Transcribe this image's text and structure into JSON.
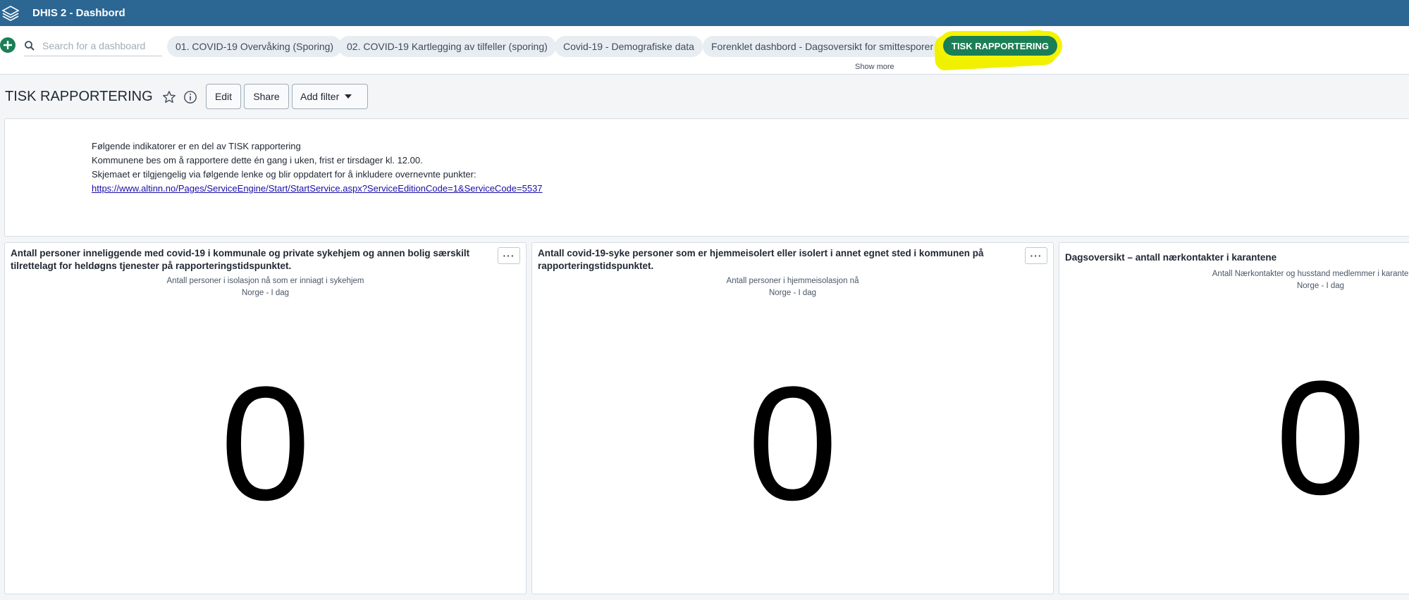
{
  "header": {
    "title": "DHIS 2 - Dashbord",
    "icon": "dhis2-logo-icon",
    "background": "#2c6693"
  },
  "controlbar": {
    "add_icon": "plus-circle-icon",
    "search_icon": "search-icon",
    "search_placeholder": "Search for a dashboard",
    "chips": [
      {
        "label": "01. COVID-19 Overvåking (Sporing)",
        "selected": false
      },
      {
        "label": "02. COVID-19 Kartlegging av tilfeller (sporing)",
        "selected": false
      },
      {
        "label": "Covid-19 - Demografiske data",
        "selected": false
      },
      {
        "label": "Forenklet dashbord - Dagsoversikt for smittesporer",
        "selected": false
      },
      {
        "label": "TISK RAPPORTERING",
        "selected": true
      }
    ],
    "show_more": "Show more",
    "accent_color": "#1b7f55",
    "highlight_color": "#f4f400"
  },
  "titlebar": {
    "title": "TISK RAPPORTERING",
    "star_icon": "star-outline-icon",
    "info_icon": "info-circle-icon",
    "edit_label": "Edit",
    "share_label": "Share",
    "add_filter_label": "Add filter",
    "dropdown_icon": "caret-down-icon"
  },
  "textitem": {
    "line1": "Følgende indikatorer er en del av TISK rapportering",
    "line2": "Kommunene bes om å rapportere dette én gang i uken, frist er tirsdager kl. 12.00.",
    "line3": "Skjemaet er tilgjengelig via følgende lenke og blir oppdatert for å inkludere overnevnte punkter:",
    "link": "https://www.altinn.no/Pages/ServiceEngine/Start/StartService.aspx?ServiceEditionCode=1&ServiceCode=5537"
  },
  "panels": [
    {
      "title": "Antall personer inneliggende med covid-19 i kommunale og private sykehjem og annen bolig særskilt tilrettelagt for heldøgns tjenester på rapporteringstidspunktet.",
      "subtitle": "Antall personer i isolasjon nå som er inniagt i sykehjem",
      "period": "Norge - I dag",
      "value": "0",
      "menu_label": "···"
    },
    {
      "title": "Antall covid-19-syke personer som er hjemmeisolert eller isolert i annet egnet sted i kommunen på rapporteringstidspunktet.",
      "subtitle": "Antall personer i hjemmeisolasjon nå",
      "period": "Norge - I dag",
      "value": "0",
      "menu_label": "···"
    },
    {
      "title": "Dagsoversikt – antall nærkontakter i karantene",
      "subtitle": "Antall Nærkontakter og husstand medlemmer i karantene nå",
      "period": "Norge - I dag",
      "value": "0",
      "menu_label": "···"
    }
  ]
}
